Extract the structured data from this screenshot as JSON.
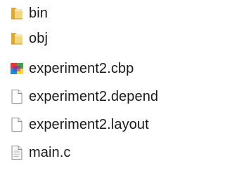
{
  "files": [
    {
      "name": "bin",
      "icon": "folder-icon"
    },
    {
      "name": "obj",
      "icon": "folder-icon"
    },
    {
      "name": "experiment2.cbp",
      "icon": "codeblocks-project-icon"
    },
    {
      "name": "experiment2.depend",
      "icon": "blank-file-icon"
    },
    {
      "name": "experiment2.layout",
      "icon": "blank-file-icon"
    },
    {
      "name": "main.c",
      "icon": "c-source-file-icon"
    }
  ],
  "colors": {
    "folder_light": "#f6d67c",
    "folder_dark": "#e0a92e",
    "text": "#1a1a1a",
    "file_border": "#8e8e8e"
  }
}
